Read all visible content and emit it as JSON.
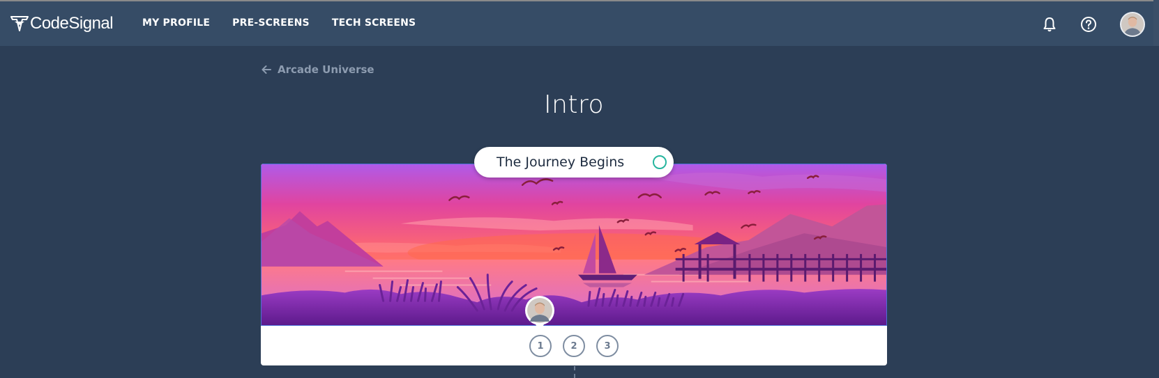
{
  "app": {
    "name": "CodeSignal",
    "logo_icon": "codesignal-logo-icon"
  },
  "nav": {
    "items": [
      {
        "label": "MY PROFILE"
      },
      {
        "label": "PRE-SCREENS"
      },
      {
        "label": "TECH SCREENS"
      }
    ]
  },
  "header_icons": [
    "bell-icon",
    "help-icon",
    "user-avatar"
  ],
  "breadcrumb": {
    "back_label": "Arcade Universe",
    "icon": "arrow-left-icon"
  },
  "page": {
    "title": "Intro"
  },
  "chapter": {
    "title": "The Journey Begins",
    "status": "not-started",
    "status_color": "#26b59e",
    "steps": [
      "1",
      "2",
      "3"
    ],
    "current_step": "1"
  },
  "colors": {
    "background": "#2c3e56",
    "topbar": "#364c66",
    "accent": "#26b59e"
  }
}
